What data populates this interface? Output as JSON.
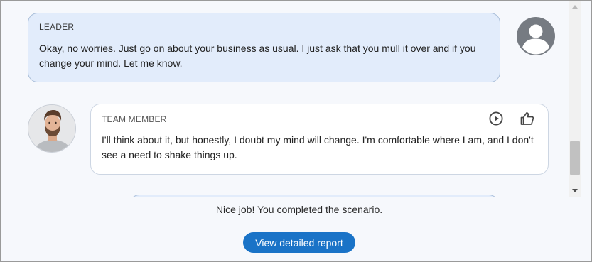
{
  "messages": [
    {
      "speaker": "LEADER",
      "text": "Okay, no worries. Just go on about your business as usual. I just ask that you mull it over and if you change your mind. Let me know.",
      "avatar_icon": "account-circle-icon"
    },
    {
      "speaker": "TEAM MEMBER",
      "text": "I'll think about it, but honestly, I doubt my mind will change. I'm comfortable where I am, and I don't see a need to shake things up.",
      "avatar_icon": "team-member-photo",
      "actions": [
        "play-circle-icon",
        "thumbs-up-icon"
      ]
    }
  ],
  "completion_text": "Nice job! You completed the scenario.",
  "report_button_label": "View detailed report",
  "colors": {
    "leader_bubble_bg": "#e2ecfb",
    "member_bubble_bg": "#ffffff",
    "accent_button": "#1a73c7"
  }
}
